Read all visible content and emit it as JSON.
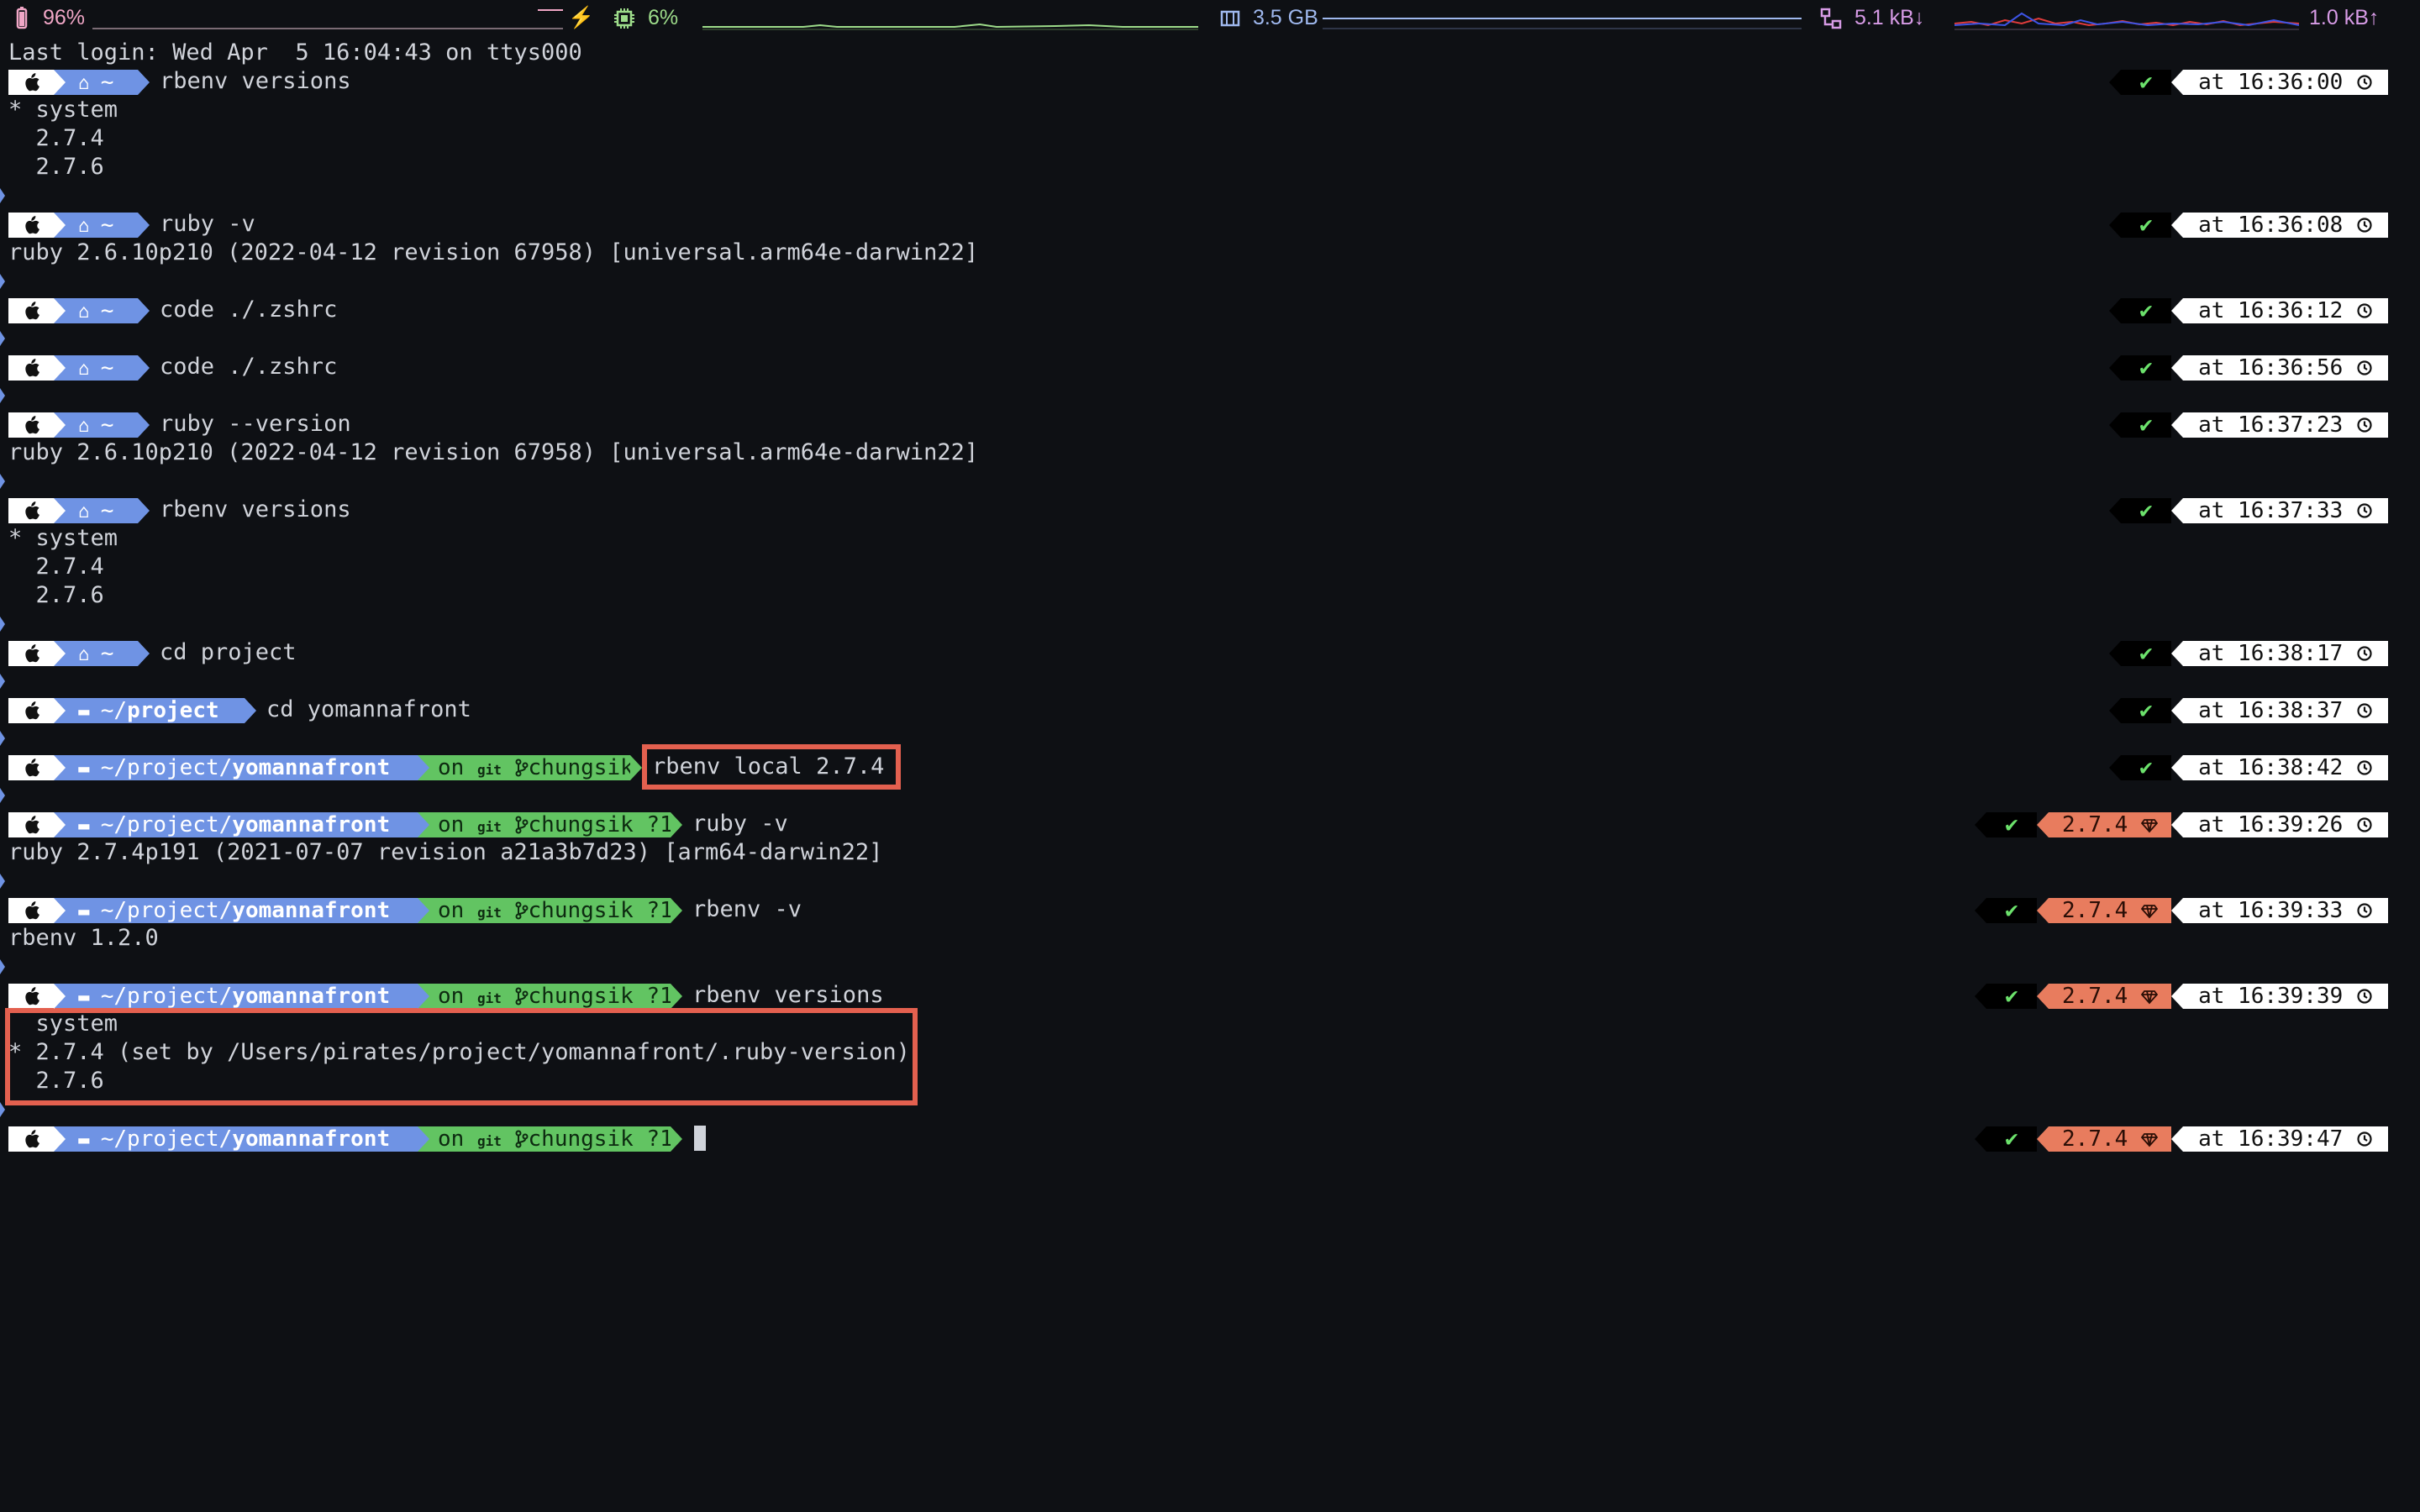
{
  "status_bar": {
    "battery": "96%",
    "cpu": "6%",
    "memory": "3.5 GB",
    "net_down": "5.1 kB↓",
    "net_up": "1.0 kB↑",
    "colors": {
      "battery": "#f0a6c6",
      "cpu": "#9ddc8a",
      "memory": "#9fb8ee",
      "net": "#d79be6"
    }
  },
  "terminal": {
    "last_login": "Last login: Wed Apr  5 16:04:43 on ttys000",
    "blocks": [
      {
        "dir": "~",
        "cmd": "rbenv versions",
        "time": "at 16:36:00",
        "output": [
          "* system",
          "  2.7.4",
          "  2.7.6"
        ]
      },
      {
        "dir": "~",
        "cmd": "ruby -v",
        "time": "at 16:36:08",
        "output": [
          "ruby 2.6.10p210 (2022-04-12 revision 67958) [universal.arm64e-darwin22]"
        ]
      },
      {
        "dir": "~",
        "cmd": "code ./.zshrc",
        "time": "at 16:36:12",
        "output": []
      },
      {
        "dir": "~",
        "cmd": "code ./.zshrc",
        "time": "at 16:36:56",
        "output": []
      },
      {
        "dir": "~",
        "cmd": "ruby --version",
        "time": "at 16:37:23",
        "output": [
          "ruby 2.6.10p210 (2022-04-12 revision 67958) [universal.arm64e-darwin22]"
        ]
      },
      {
        "dir": "~",
        "cmd": "rbenv versions",
        "time": "at 16:37:33",
        "output": [
          "* system",
          "  2.7.4",
          "  2.7.6"
        ]
      },
      {
        "dir": "~",
        "cmd": "cd project",
        "time": "at 16:38:17",
        "output": []
      },
      {
        "dir_prefix": "~/",
        "dir_bold": "project",
        "cmd": "cd yomannafront",
        "time": "at 16:38:37",
        "output": []
      },
      {
        "dir_prefix": "~/project/",
        "dir_bold": "yomannafront",
        "git": "on  chungsik",
        "cmd": "rbenv local 2.7.4",
        "time": "at 16:38:42",
        "output": []
      },
      {
        "dir_prefix": "~/project/",
        "dir_bold": "yomannafront",
        "git": "on  chungsik ?1",
        "cmd": "ruby -v",
        "ruby": "2.7.4",
        "time": "at 16:39:26",
        "output": [
          "ruby 2.7.4p191 (2021-07-07 revision a21a3b7d23) [arm64-darwin22]"
        ]
      },
      {
        "dir_prefix": "~/project/",
        "dir_bold": "yomannafront",
        "git": "on  chungsik ?1",
        "cmd": "rbenv -v",
        "ruby": "2.7.4",
        "time": "at 16:39:33",
        "output": [
          "rbenv 1.2.0"
        ]
      },
      {
        "dir_prefix": "~/project/",
        "dir_bold": "yomannafront",
        "git": "on  chungsik ?1",
        "cmd": "rbenv versions",
        "ruby": "2.7.4",
        "time": "at 16:39:39",
        "output": [
          "  system",
          "* 2.7.4 (set by /Users/pirates/project/yomannafront/.ruby-version)",
          "  2.7.6"
        ]
      },
      {
        "dir_prefix": "~/project/",
        "dir_bold": "yomannafront",
        "git": "on  chungsik ?1",
        "cmd": "",
        "ruby": "2.7.4",
        "time": "at 16:39:47",
        "output": []
      }
    ],
    "check_mark": "✔",
    "git_label": "git",
    "colors": {
      "dir_segment": "#6f93e4",
      "git_segment": "#62c462",
      "ruby_segment": "#e87c5e",
      "highlight_box": "#e3604f"
    }
  }
}
